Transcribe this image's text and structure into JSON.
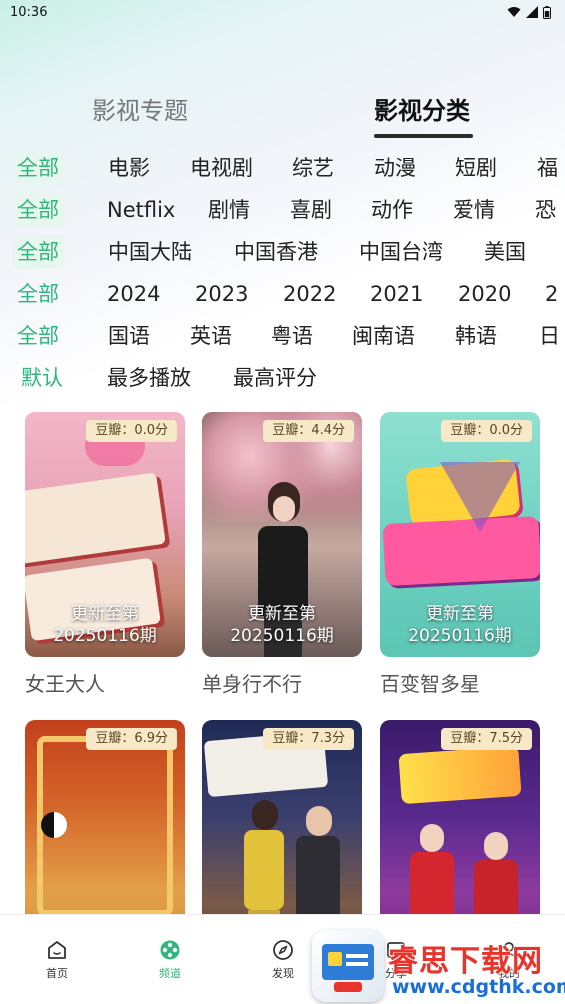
{
  "status_bar": {
    "time": "10:36"
  },
  "tabs": {
    "topic": "影视专题",
    "category": "影视分类"
  },
  "filters": {
    "type": {
      "all": "全部",
      "items": [
        "电影",
        "电视剧",
        "综艺",
        "动漫",
        "短剧",
        "福"
      ]
    },
    "genre": {
      "all": "全部",
      "items": [
        "Netflix",
        "剧情",
        "喜剧",
        "动作",
        "爱情",
        "恐"
      ]
    },
    "region": {
      "all": "全部",
      "items": [
        "中国大陆",
        "中国香港",
        "中国台湾",
        "美国"
      ]
    },
    "year": {
      "all": "全部",
      "items": [
        "2024",
        "2023",
        "2022",
        "2021",
        "2020",
        "2"
      ]
    },
    "language": {
      "all": "全部",
      "items": [
        "国语",
        "英语",
        "粤语",
        "闽南语",
        "韩语",
        "日"
      ]
    },
    "sort": {
      "default": "默认",
      "items": [
        "最多播放",
        "最高评分"
      ]
    }
  },
  "cards": [
    {
      "title": "女王大人",
      "rating": "豆瓣：0.0分",
      "update": "更新至第\n20250116期"
    },
    {
      "title": "单身行不行",
      "rating": "豆瓣：4.4分",
      "update": "更新至第\n20250116期"
    },
    {
      "title": "百变智多星",
      "rating": "豆瓣：0.0分",
      "update": "更新至第\n20250116期"
    },
    {
      "title": "",
      "rating": "豆瓣：6.9分",
      "update": ""
    },
    {
      "title": "",
      "rating": "豆瓣：7.3分",
      "update": ""
    },
    {
      "title": "",
      "rating": "豆瓣：7.5分",
      "update": ""
    }
  ],
  "nav": {
    "home": "首页",
    "channel": "频道",
    "discover": "发现",
    "share": "分享",
    "mine": "我的"
  },
  "watermark": {
    "name": "睿思下载网",
    "url": "www.cdgthk.com"
  },
  "colors": {
    "accent": "#2fb67c",
    "badge_bg": "#f7e9c8",
    "watermark_red": "#e8342a",
    "watermark_blue": "#1a6fd6"
  }
}
